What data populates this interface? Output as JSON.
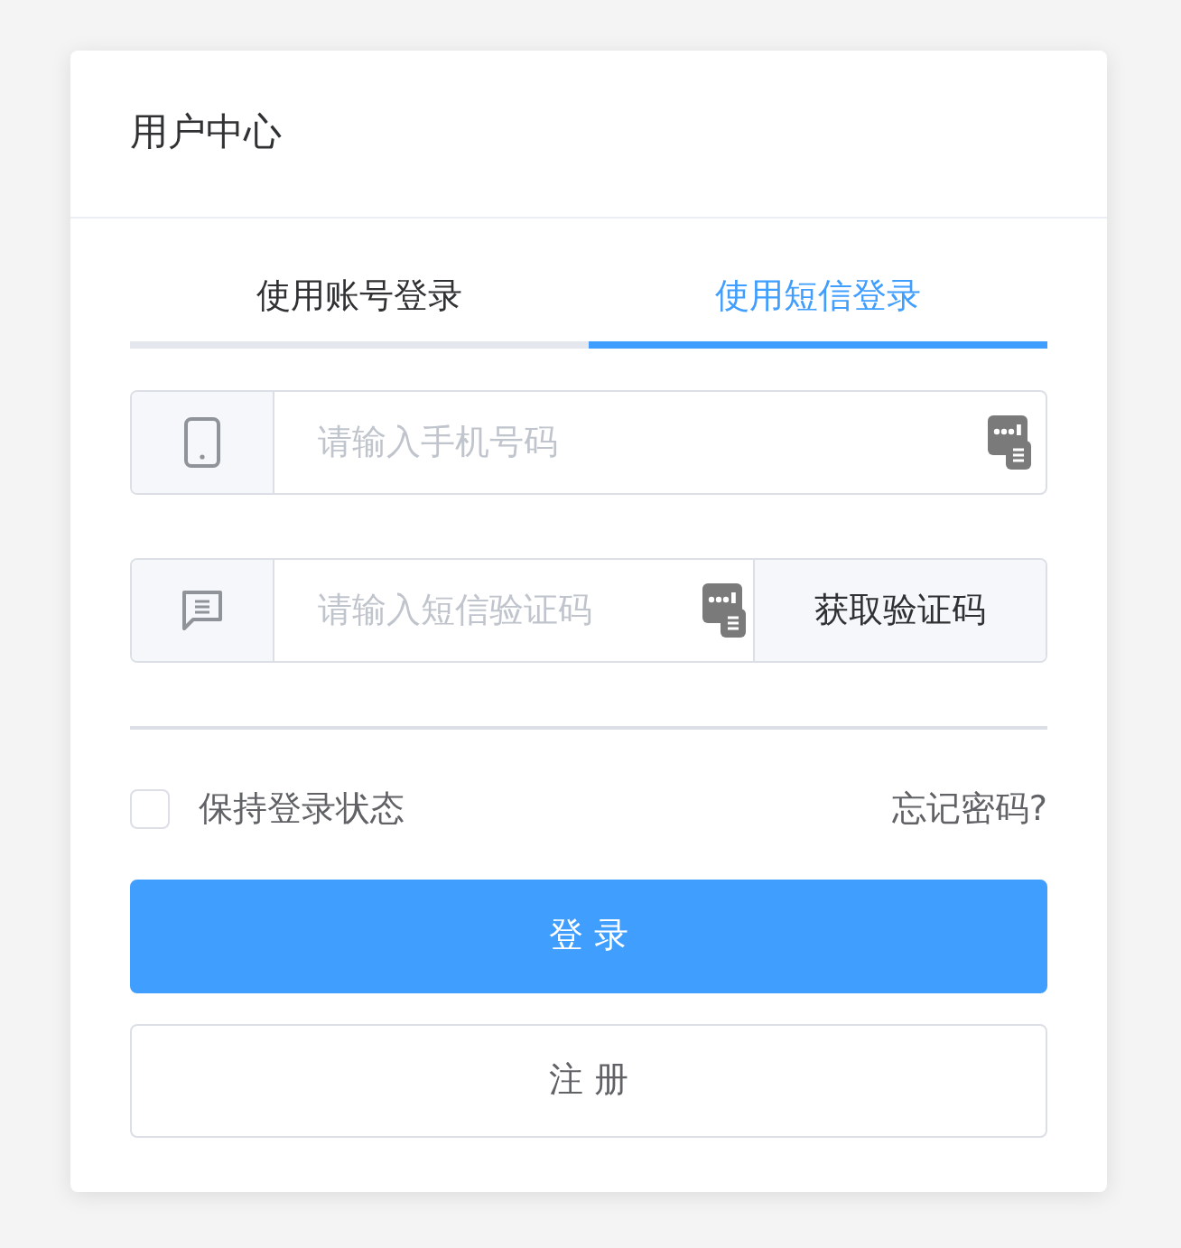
{
  "card": {
    "title": "用户中心"
  },
  "tabs": [
    {
      "label": "使用账号登录",
      "selected": false
    },
    {
      "label": "使用短信登录",
      "selected": true
    }
  ],
  "phone_field": {
    "placeholder": "请输入手机号码"
  },
  "code_field": {
    "placeholder": "请输入短信验证码",
    "button": "获取验证码"
  },
  "remember": {
    "label": "保持登录状态",
    "checked": false
  },
  "forgot_link": "忘记密码?",
  "buttons": [
    {
      "label": "登 录",
      "kind": "primary"
    },
    {
      "label": "注 册",
      "kind": "secondary"
    }
  ]
}
